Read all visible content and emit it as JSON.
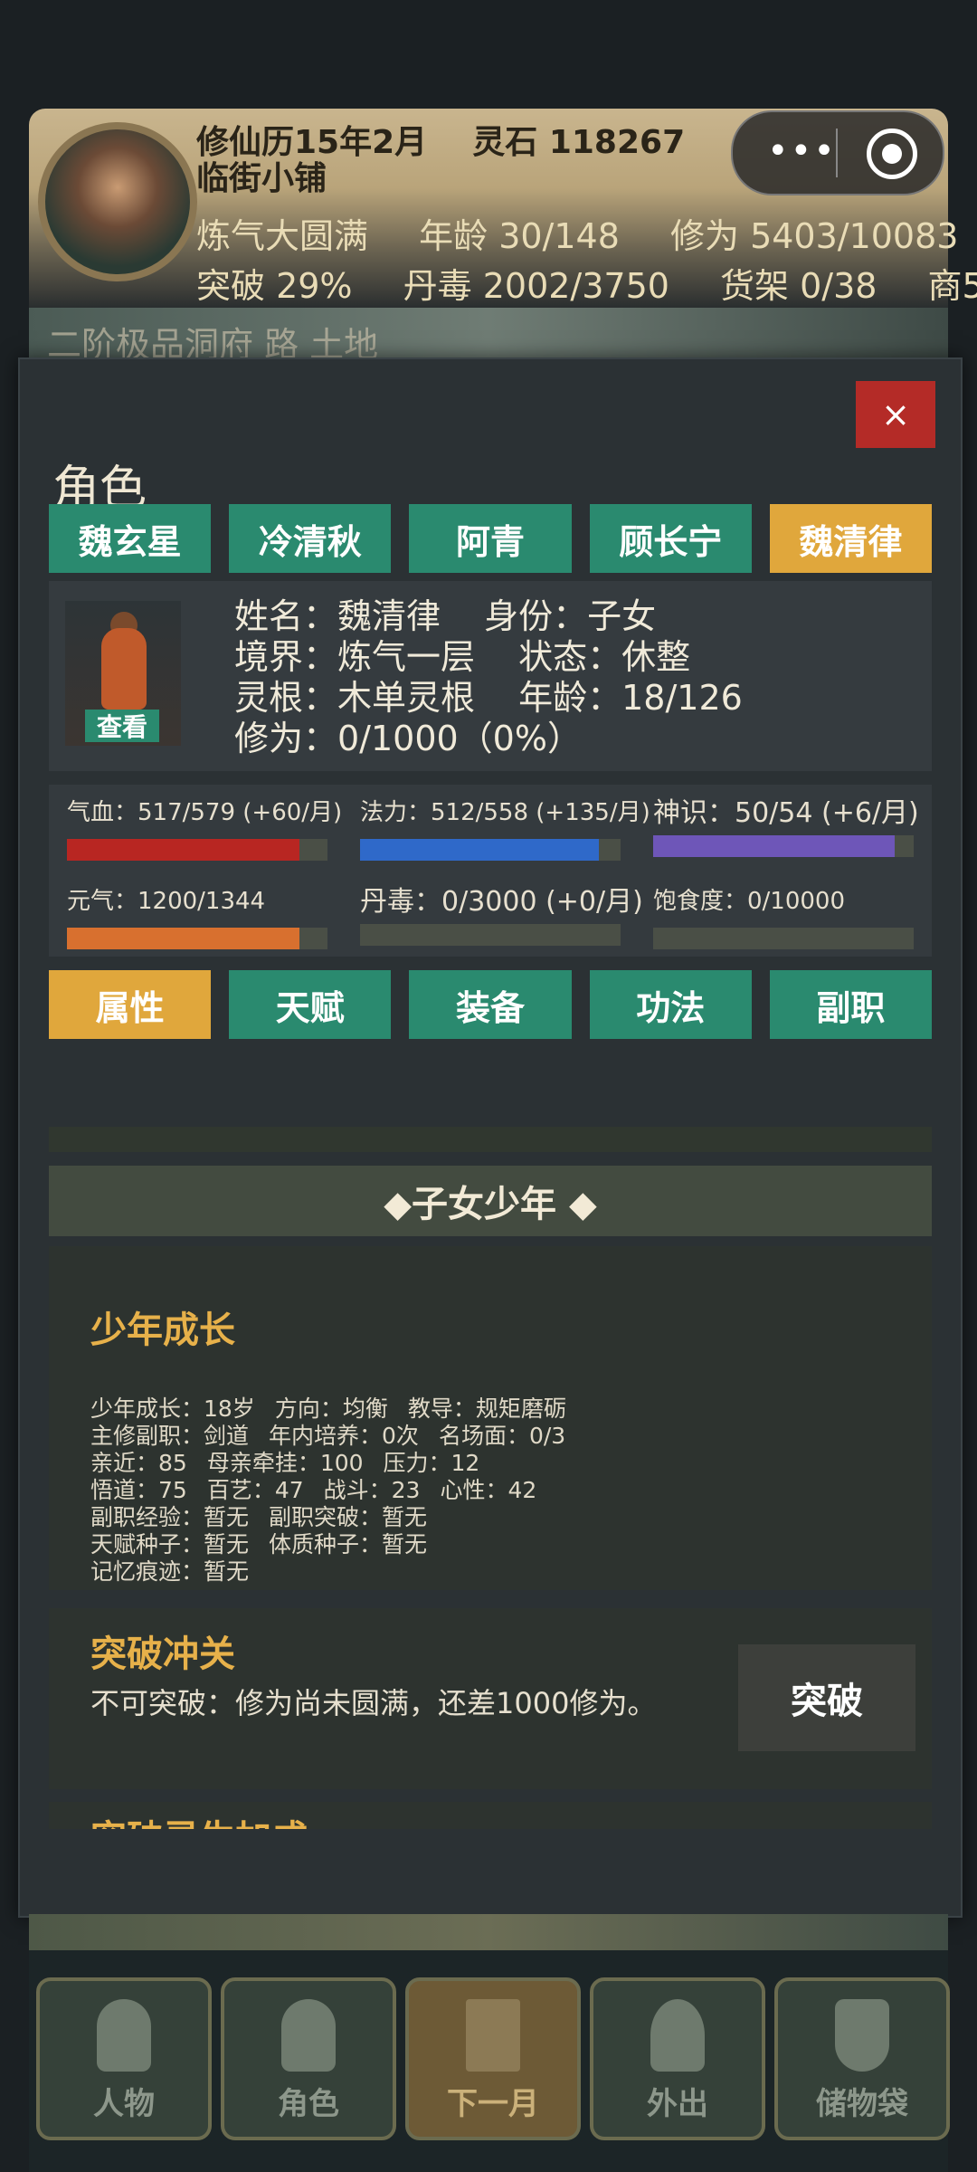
{
  "header": {
    "date": "修仙历15年2月",
    "stones": "灵石 118267",
    "shop": "临街小铺",
    "realm": "炼气大圆满",
    "age": "年龄 30/148",
    "cultivation": "修为 5403/10083",
    "breakthrough": "突破 29%",
    "poison": "丹毒 2002/3750",
    "shelf": "货架 0/38",
    "merchant": "商5",
    "scenery_text": "二阶极品洞府 路 土地"
  },
  "capsule": {
    "more": "•••",
    "target": "◉"
  },
  "modal": {
    "close": "×",
    "title": "角色",
    "tabs": [
      "魏玄星",
      "冷清秋",
      "阿青",
      "顾长宁",
      "魏清律"
    ],
    "active_tab": 4,
    "view": "查看",
    "info": {
      "name": "姓名：魏清律",
      "identity": "身份：子女",
      "realm": "境界：炼气一层",
      "status": "状态：休整",
      "root": "灵根：木单灵根",
      "age": "年龄：18/126",
      "cultivation": "修为：0/1000（0%）"
    },
    "stats": [
      {
        "label": "气血：517/579 (+60/月)",
        "fraction": 0.893,
        "color": "#b82622"
      },
      {
        "label": "法力：512/558 (+135/月)",
        "fraction": 0.918,
        "color": "#2f69c9"
      },
      {
        "label": "神识：50/54 (+6/月)",
        "fraction": 0.926,
        "color": "#6e56b8"
      },
      {
        "label": "元气：1200/1344",
        "fraction": 0.893,
        "color": "#d8702f"
      },
      {
        "label": "丹毒：0/3000 (+0/月)",
        "fraction": 0.0,
        "color": "#d8702f"
      },
      {
        "label": "饱食度：0/10000",
        "fraction": 0.0,
        "color": "#d8702f"
      }
    ],
    "subtabs": [
      "属性",
      "天赋",
      "装备",
      "功法",
      "副职"
    ],
    "active_subtab": 0,
    "section_header": "◆子女少年 ◆",
    "growth": {
      "title": "少年成长",
      "lines": [
        [
          "少年成长：18岁",
          "方向：均衡",
          "教导：规矩磨砺"
        ],
        [
          "主修副职：剑道",
          "年内培养：0次",
          "名场面：0/3"
        ],
        [
          "亲近：85",
          "母亲牵挂：100",
          "压力：12"
        ],
        [
          "悟道：75",
          "百艺：47",
          "战斗：23",
          "心性：42"
        ],
        [
          "副职经验：暂无",
          "副职突破：暂无"
        ],
        [
          "天赋种子：暂无",
          "体质种子：暂无"
        ],
        [
          "记忆痕迹：暂无"
        ]
      ]
    },
    "breakthrough": {
      "title": "突破冲关",
      "text": "不可突破：修为尚未圆满，还差1000修为。",
      "button": "突破"
    },
    "bonus_title": "突破灵生加成"
  },
  "nav": [
    {
      "label": "人物"
    },
    {
      "label": "角色"
    },
    {
      "label": "下一月"
    },
    {
      "label": "外出"
    },
    {
      "label": "储物袋"
    }
  ],
  "nav_active": 2
}
